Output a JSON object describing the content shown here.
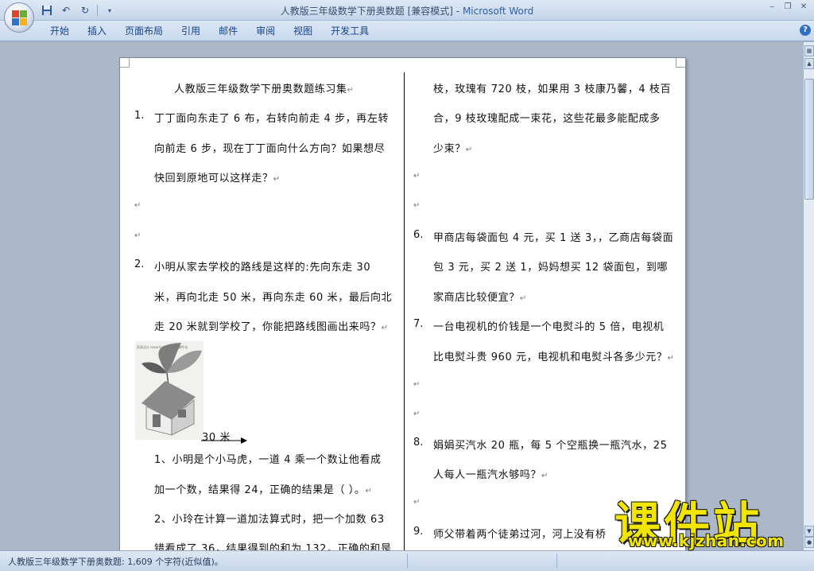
{
  "window": {
    "title_doc": "人教版三年级数学下册奥数题 [兼容模式]",
    "title_sep": " - ",
    "title_app": "Microsoft Word"
  },
  "ribbon": {
    "tabs": [
      "开始",
      "插入",
      "页面布局",
      "引用",
      "邮件",
      "审阅",
      "视图",
      "开发工具"
    ]
  },
  "document": {
    "title": "人教版三年级数学下册奥数题练习集",
    "left": {
      "q1_num": "1.",
      "q1_lines": [
        "丁丁面向东走了 6 布，右转向前走 4 步，再左转",
        "向前走 6 步，现在丁丁面向什么方向？如果想尽",
        "快回到原地可以这样走？"
      ],
      "q2_num": "2.",
      "q2_lines": [
        "小明从家去学校的路线是这样的:先向东走  30",
        "米，再向北走 50 米，再向东走 60 米，最后向北",
        "走 20 米就到学校了，你能把路线图画出来吗？"
      ],
      "diagram_label": "30 米",
      "picture_caption": "家具设计 www.kjzhan.com 课件站",
      "s1_lines": [
        "1、小明是个小马虎，一道 4  乘一个数让他看成",
        "加一个数，结果得 24，正确的结果是（         ）。"
      ],
      "s2_lines": [
        "2、小玲在计算一道加法算式时，把一个加数 63",
        "错看成了 36，结果得到的和为 132，正确的和是"
      ]
    },
    "right": {
      "cont_lines": [
        "枝，玫瑰有 720 枝，如果用 3 枝康乃馨，4 枝百",
        "合，9 枝玫瑰配成一束花，这些花最多能配成多",
        "少束？"
      ],
      "q6_num": "6.",
      "q6_lines": [
        "甲商店每袋面包 4 元，买 1 送 3，，乙商店每袋面",
        "包 3 元，买 2 送 1，妈妈想买 12 袋面包，到哪",
        "家商店比较便宜？"
      ],
      "q7_num": "7.",
      "q7_lines": [
        "一台电视机的价钱是一个电熨斗的 5 倍，电视机",
        "比电熨斗贵 960 元，电视机和电熨斗各多少元？"
      ],
      "q8_num": "8.",
      "q8_lines": [
        "娟娟买汽水 20 瓶，每 5 个空瓶换一瓶汽水，25",
        "人每人一瓶汽水够吗？"
      ],
      "q9_num": "9.",
      "q9_line": "师父带着两个徒弟过河，河上没有桥"
    },
    "paragraph_mark": "↵"
  },
  "statusbar": {
    "text": "人教版三年级数学下册奥数题: 1,609 个字符(近似值)。"
  },
  "watermark": {
    "brand": "课件站",
    "url": "www.kjzhan.com"
  },
  "colors": {
    "title_app": "#2f5fa8",
    "ribbon_tab_text": "#15428b",
    "workspace": "#acb8c8",
    "watermark_yellow": "#f2e600"
  },
  "icons": {
    "office_button": "office-logo-icon",
    "save": "save-icon",
    "undo": "undo-icon",
    "redo": "redo-icon",
    "customize": "customize-qat-icon",
    "help": "help-icon"
  }
}
